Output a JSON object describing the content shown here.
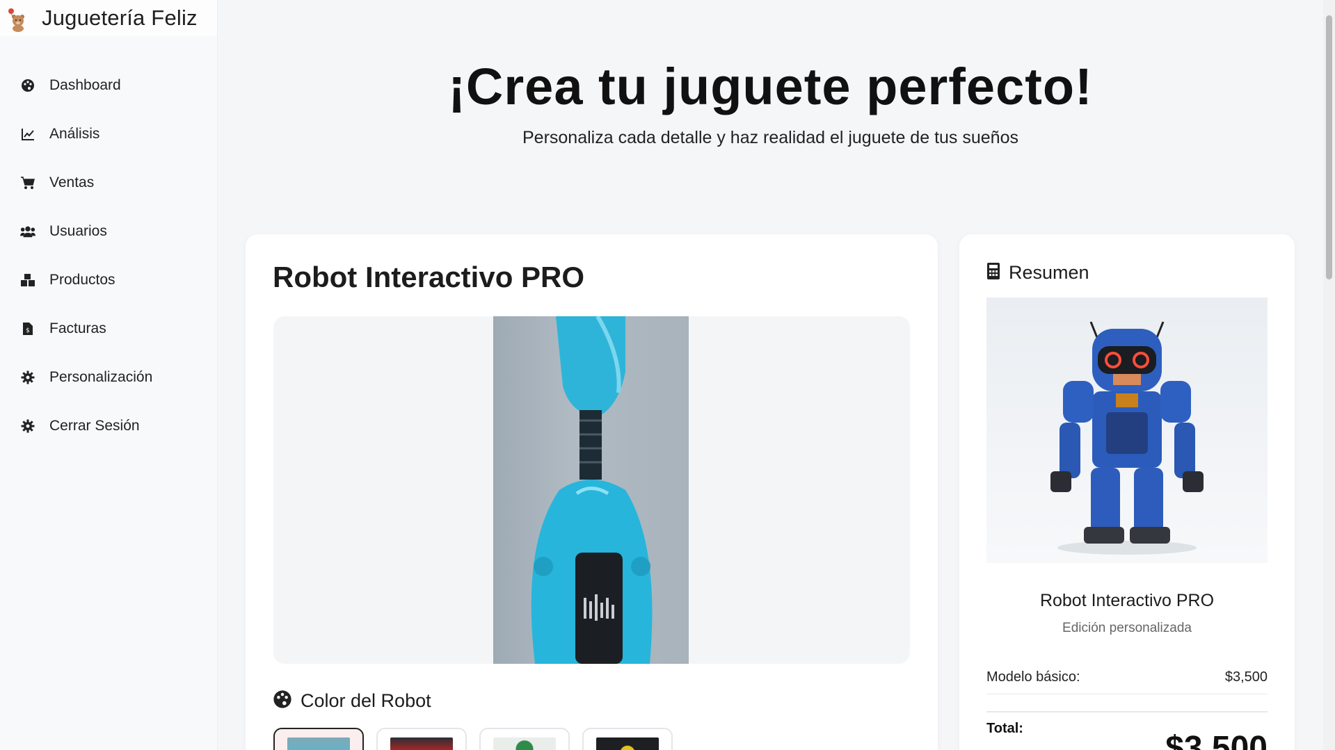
{
  "brand": {
    "title": "Juguetería Feliz",
    "logo_icon": "teddy-bear-icon"
  },
  "sidebar": {
    "items": [
      {
        "label": "Dashboard",
        "icon": "palette-icon"
      },
      {
        "label": "Análisis",
        "icon": "line-chart-icon"
      },
      {
        "label": "Ventas",
        "icon": "cart-icon"
      },
      {
        "label": "Usuarios",
        "icon": "users-icon"
      },
      {
        "label": "Productos",
        "icon": "boxes-icon"
      },
      {
        "label": "Facturas",
        "icon": "invoice-icon"
      },
      {
        "label": "Personalización",
        "icon": "gear-icon"
      },
      {
        "label": "Cerrar Sesión",
        "icon": "gear-icon"
      }
    ]
  },
  "hero": {
    "title": "¡Crea tu juguete perfecto!",
    "subtitle": "Personaliza cada detalle y haz realidad el juguete de tus sueños"
  },
  "main": {
    "product_title": "Robot Interactivo PRO",
    "color_section_label": "Color del Robot",
    "color_options": [
      {
        "name": "cyan",
        "color": "#36c2e4",
        "selected": true
      },
      {
        "name": "red",
        "color": "#c42424",
        "selected": false
      },
      {
        "name": "green",
        "color": "#2e8b4a",
        "selected": false
      },
      {
        "name": "yellow",
        "color": "#e2c51c",
        "selected": false
      }
    ]
  },
  "summary": {
    "heading": "Resumen",
    "product_name": "Robot Interactivo PRO",
    "edition": "Edición personalizada",
    "base_model_label": "Modelo básico:",
    "base_model_price": "$3,500",
    "total_label": "Total:",
    "total_value": "$3,500"
  }
}
